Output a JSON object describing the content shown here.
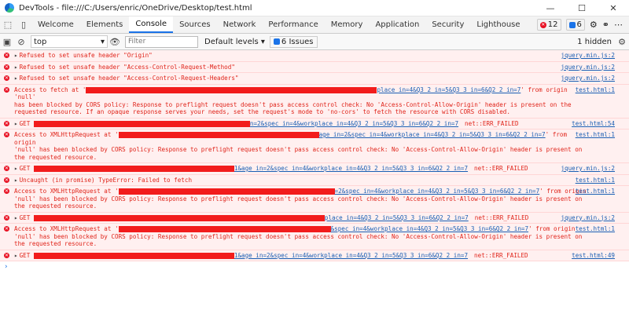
{
  "window": {
    "title": "DevTools - file:///C:/Users/enric/OneDrive/Desktop/test.html"
  },
  "tabs": [
    "Welcome",
    "Elements",
    "Console",
    "Sources",
    "Network",
    "Performance",
    "Memory",
    "Application",
    "Security",
    "Lighthouse"
  ],
  "tab_badges": {
    "errors": "12",
    "issues": "6"
  },
  "toolbar": {
    "context": "top",
    "filter_placeholder": "Filter",
    "levels": "Default levels ▾",
    "issues": "6 Issues",
    "hidden": "1 hidden"
  },
  "messages": [
    {
      "id": "r1",
      "expand": true,
      "text": "Refused to set unsafe header \"Origin\"",
      "source": "jquery.min.js:2"
    },
    {
      "id": "r2",
      "expand": true,
      "text": "Refused to set unsafe header \"Access-Control-Request-Method\"",
      "source": "jquery.min.js:2"
    },
    {
      "id": "r3",
      "expand": true,
      "text": "Refused to set unsafe header \"Access-Control-Request-Headers\"",
      "source": "jquery.min.js:2"
    },
    {
      "id": "r4",
      "prefix": "Access to fetch at '",
      "url_tail": "place_in=4&Q3_2_in=5&Q3_3_in=6&Q2_2_in=7",
      "tail": "' from origin 'null'",
      "cont": "has been blocked by CORS policy: Response to preflight request doesn't pass access control check: No 'Access-Control-Allow-Origin' header is present on the requested resource. If an opaque response serves your needs, set the request's mode to 'no-cors' to fetch the resource with CORS disabled.",
      "source": "test.html:1"
    },
    {
      "id": "r5",
      "expand": true,
      "prefix": "GET ",
      "url_tail": "n=2&spec_in=4&workplace_in=4&Q3_2_in=5&Q3_3_in=6&Q2_2_in=7",
      "neterr": "net::ERR_FAILED",
      "source": "test.html:54"
    },
    {
      "id": "r6",
      "prefix": "Access to XMLHttpRequest at '",
      "url_tail": "age_in=2&spec_in=4&workplace_in=4&Q3_2_in=5&Q3_3_in=6&Q2_2_in=7",
      "tail": "' from origin",
      "cont": "'null' has been blocked by CORS policy: Response to preflight request doesn't pass access control check: No 'Access-Control-Allow-Origin' header is present on the requested resource.",
      "source": "test.html:1"
    },
    {
      "id": "r7",
      "expand": true,
      "prefix": "GET ",
      "url_tail": "1&age_in=2&spec_in=4&workplace_in=4&Q3_2_in=5&Q3_3_in=6&Q2_2_in=7",
      "neterr": "net::ERR_FAILED",
      "source": "jquery.min.js:2"
    },
    {
      "id": "r8",
      "expand": true,
      "text": "Uncaught (in promise) TypeError: Failed to fetch",
      "source": "test.html:1"
    },
    {
      "id": "r9",
      "prefix": "Access to XMLHttpRequest at '",
      "url_tail": "=2&spec_in=4&workplace_in=4&Q3_2_in=5&Q3_3_in=6&Q2_2_in=7",
      "tail": "' from origin",
      "cont": "'null' has been blocked by CORS policy: Response to preflight request doesn't pass access control check: No 'Access-Control-Allow-Origin' header is present on the requested resource.",
      "source": "test.html:1"
    },
    {
      "id": "r10",
      "expand": true,
      "prefix": "GET ",
      "url_tail": "place_in=4&Q3_2_in=5&Q3_3_in=6&Q2_2_in=7",
      "neterr": "net::ERR_FAILED",
      "source": "jquery.min.js:2"
    },
    {
      "id": "r11",
      "prefix": "Access to XMLHttpRequest at '",
      "url_tail": "&spec_in=4&workplace_in=4&Q3_2_in=5&Q3_3_in=6&Q2_2_in=7",
      "tail": "' from origin",
      "cont": "'null' has been blocked by CORS policy: Response to preflight request doesn't pass access control check: No 'Access-Control-Allow-Origin' header is present on the requested resource.",
      "source": "test.html:1"
    },
    {
      "id": "r12",
      "expand": true,
      "prefix": "GET ",
      "url_tail": "1&age_in=2&spec_in=4&workplace_in=4&Q3_2_in=5&Q3_3_in=6&Q2_2_in=7",
      "neterr": "net::ERR_FAILED",
      "source": "test.html:49"
    }
  ],
  "prompt": "›"
}
